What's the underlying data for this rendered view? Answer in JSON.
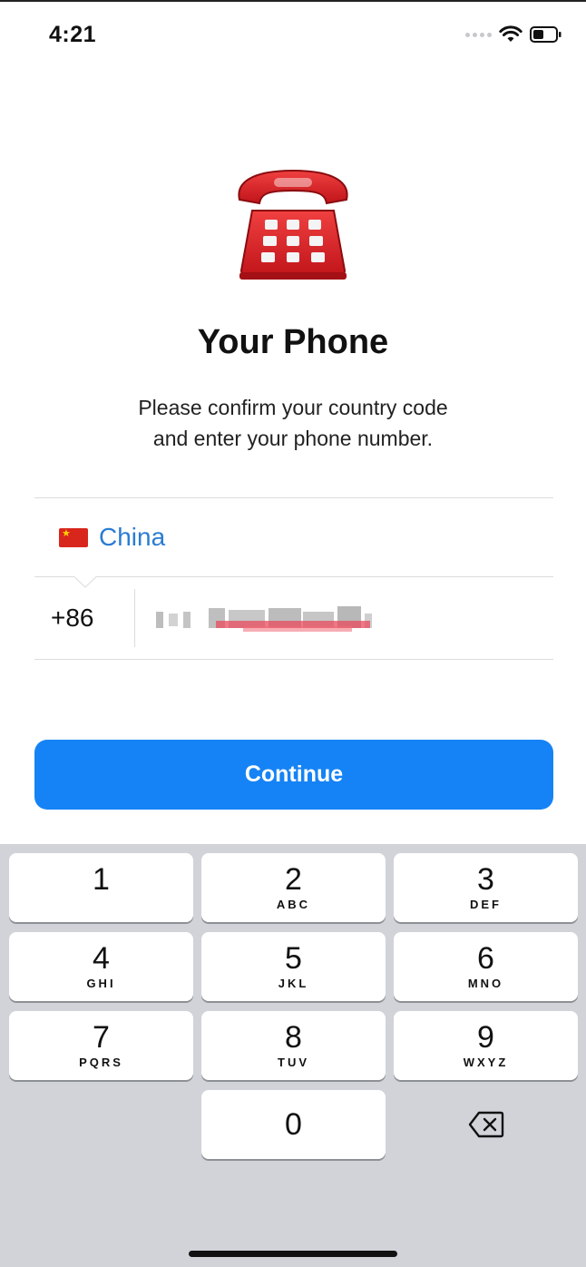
{
  "status_bar": {
    "time": "4:21",
    "icons": [
      "signal-dots-icon",
      "wifi-icon",
      "battery-icon"
    ]
  },
  "header": {
    "illustration": "telephone-icon",
    "title": "Your Phone",
    "subtitle_line1": "Please confirm your country code",
    "subtitle_line2": "and enter your phone number."
  },
  "form": {
    "country": {
      "flag": "china-flag-icon",
      "name": "China"
    },
    "country_code": "+86",
    "phone_number": ""
  },
  "continue_label": "Continue",
  "keypad": {
    "keys": [
      {
        "digit": "1",
        "letters": ""
      },
      {
        "digit": "2",
        "letters": "ABC"
      },
      {
        "digit": "3",
        "letters": "DEF"
      },
      {
        "digit": "4",
        "letters": "GHI"
      },
      {
        "digit": "5",
        "letters": "JKL"
      },
      {
        "digit": "6",
        "letters": "MNO"
      },
      {
        "digit": "7",
        "letters": "PQRS"
      },
      {
        "digit": "8",
        "letters": "TUV"
      },
      {
        "digit": "9",
        "letters": "WXYZ"
      },
      {
        "digit": "0",
        "letters": ""
      }
    ],
    "backspace_icon": "backspace-icon"
  },
  "colors": {
    "accent": "#1583f5",
    "link": "#2a7cd3",
    "keypad_bg": "#d1d3d9"
  }
}
